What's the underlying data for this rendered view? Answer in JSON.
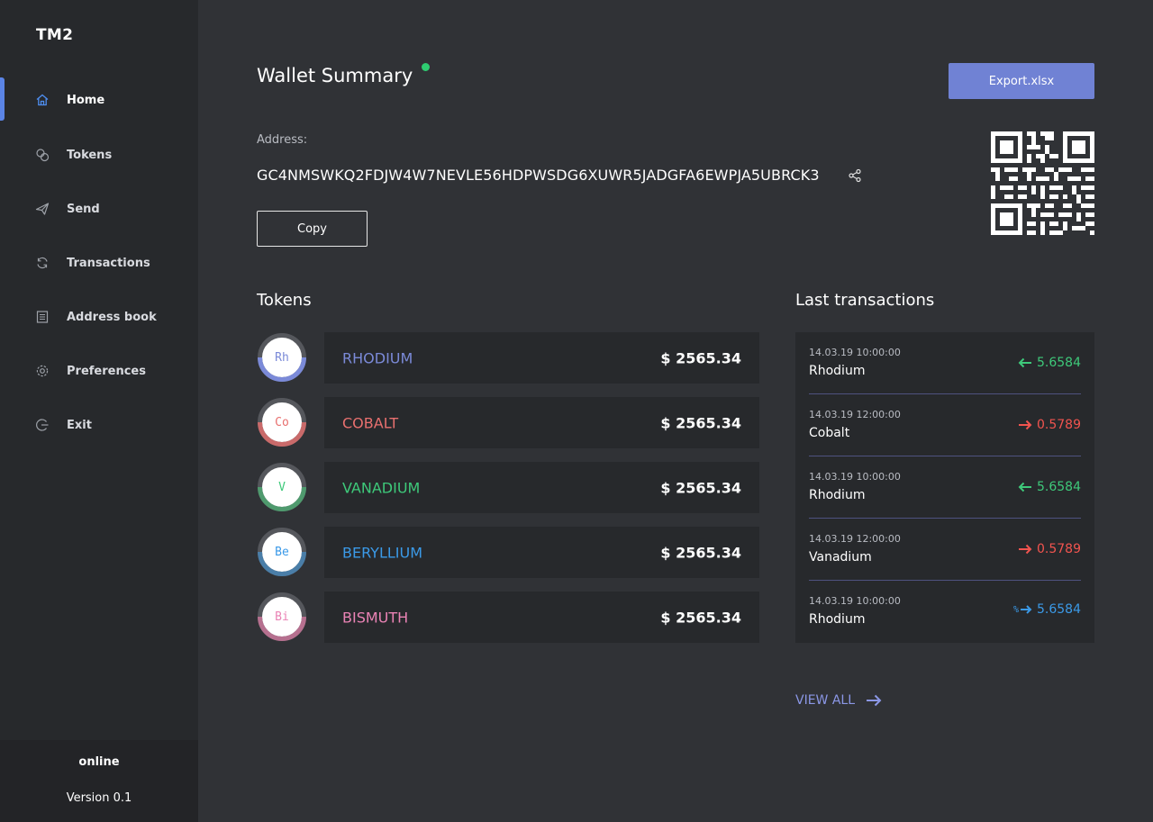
{
  "app": {
    "logo": "TM2"
  },
  "sidebar": {
    "items": [
      {
        "label": "Home",
        "icon": "home-icon"
      },
      {
        "label": "Tokens",
        "icon": "tokens-icon"
      },
      {
        "label": "Send",
        "icon": "send-icon"
      },
      {
        "label": "Transactions",
        "icon": "transactions-icon"
      },
      {
        "label": "Address book",
        "icon": "address-book-icon"
      },
      {
        "label": "Preferences",
        "icon": "gear-icon"
      },
      {
        "label": "Exit",
        "icon": "exit-icon"
      }
    ],
    "active": "Home",
    "status": "online",
    "version": "Version 0.1"
  },
  "header": {
    "title": "Wallet Summary",
    "status_color": "#2ecc71",
    "export_label": "Export.xlsx"
  },
  "address": {
    "label": "Address:",
    "value": "GC4NMSWKQ2FDJW4W7NEVLE56HDPWSDG6XUWR5JADGFA6EWPJA5UBRCK3",
    "copy_label": "Copy"
  },
  "tokens": {
    "title": "Tokens",
    "items": [
      {
        "symbol": "Rh",
        "name": "RHODIUM",
        "balance": "$ 2565.34",
        "color": "#7b8ad8"
      },
      {
        "symbol": "Co",
        "name": "COBALT",
        "balance": "$ 2565.34",
        "color": "#e8706f"
      },
      {
        "symbol": "V",
        "name": "VANADIUM",
        "balance": "$ 2565.34",
        "color": "#3ec97a"
      },
      {
        "symbol": "Be",
        "name": "BERYLLIUM",
        "balance": "$ 2565.34",
        "color": "#3b9ae8"
      },
      {
        "symbol": "Bi",
        "name": "BISMUTH",
        "balance": "$ 2565.34",
        "color": "#ea83b5"
      }
    ]
  },
  "transactions": {
    "title": "Last transactions",
    "items": [
      {
        "date": "14.03.19 10:00:00",
        "token": "Rhodium",
        "amount": "5.6584",
        "direction": "in",
        "color": "#3ec97a",
        "prefix": ""
      },
      {
        "date": "14.03.19 12:00:00",
        "token": "Cobalt",
        "amount": "0.5789",
        "direction": "out",
        "color": "#f2544f",
        "prefix": ""
      },
      {
        "date": "14.03.19 10:00:00",
        "token": "Rhodium",
        "amount": "5.6584",
        "direction": "in",
        "color": "#3ec97a",
        "prefix": ""
      },
      {
        "date": "14.03.19 12:00:00",
        "token": "Vanadium",
        "amount": "0.5789",
        "direction": "out",
        "color": "#f2544f",
        "prefix": ""
      },
      {
        "date": "14.03.19 10:00:00",
        "token": "Rhodium",
        "amount": "5.6584",
        "direction": "exchange",
        "color": "#3b9ae8",
        "prefix": "%"
      }
    ],
    "view_all": "VIEW ALL"
  }
}
